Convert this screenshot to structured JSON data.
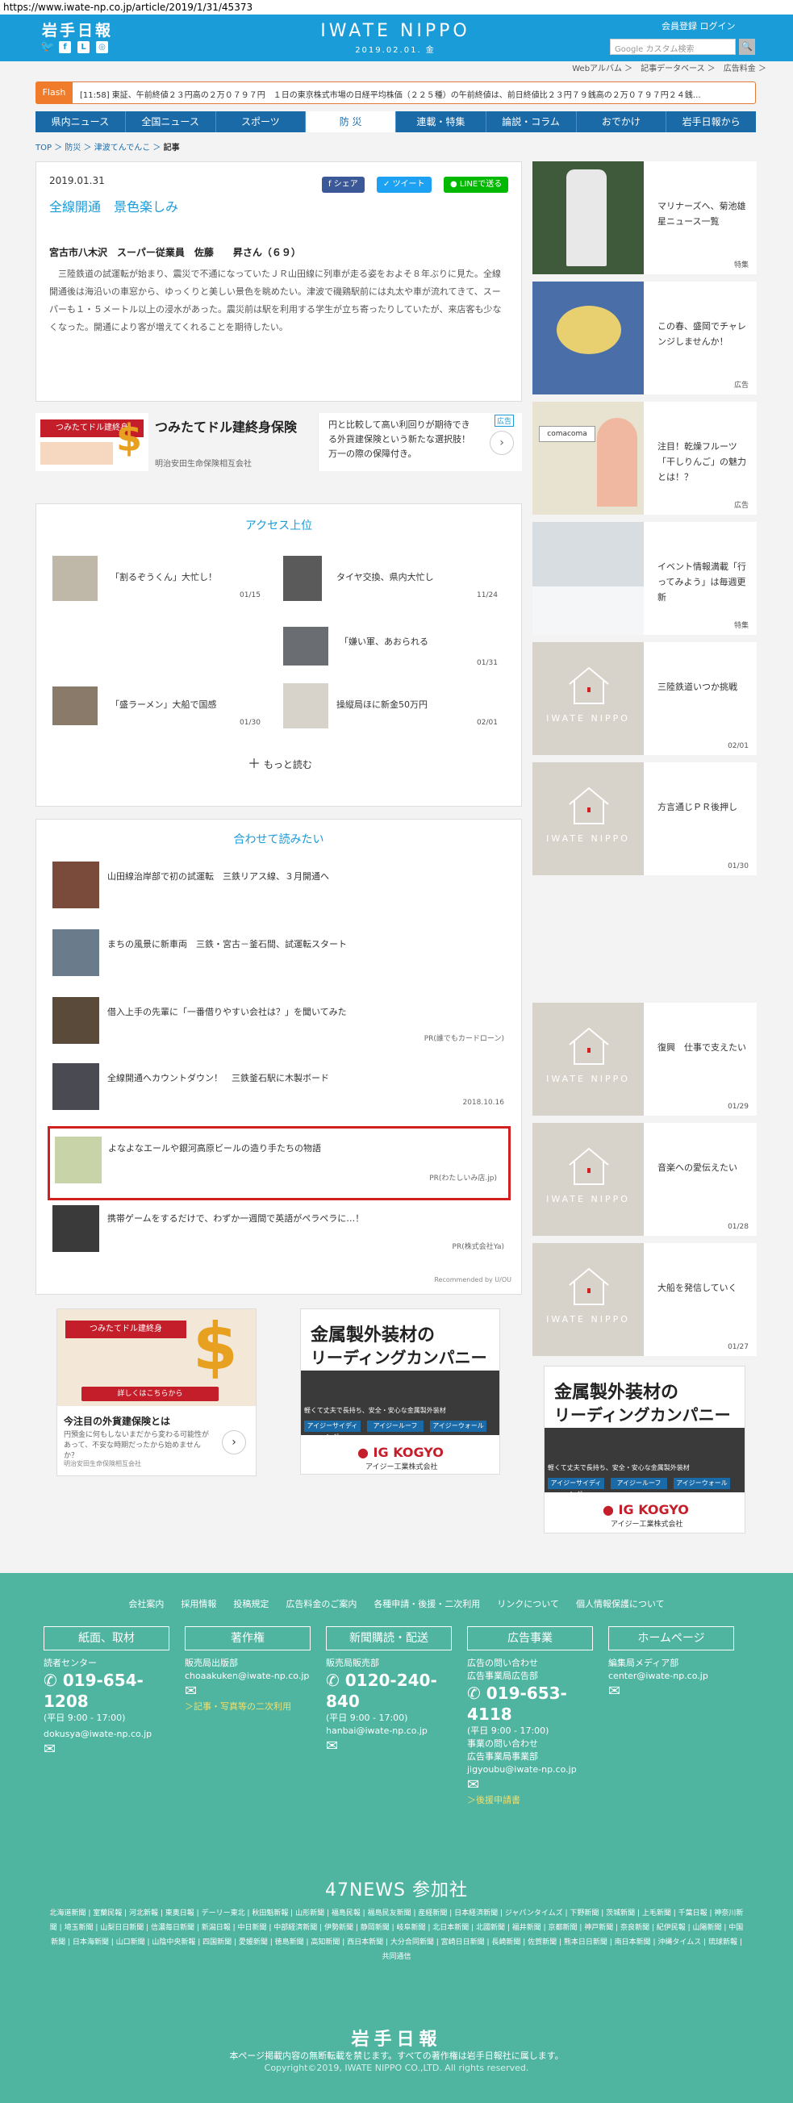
{
  "url": "https://www.iwate-np.co.jp/article/2019/1/31/45373",
  "header": {
    "logo_jp": "岩手日報",
    "logo_en": "IWATE NIPPO",
    "date": "2019.02.01. 金",
    "member_links": "会員登録  ログイン",
    "search_placeholder": "Google カスタム検索",
    "sub_links": "Webアルバム ＞　記事データベース ＞　広告料金 ＞"
  },
  "flash": {
    "tag": "Flash",
    "text": "[11:58] 東証、午前終値２３円高の２万０７９７円　１日の東京株式市場の日経平均株価（２２５種）の午前終値は、前日終値比２３円７９銭高の２万０７９７円２４銭…"
  },
  "nav": [
    "県内ニュース",
    "全国ニュース",
    "スポーツ",
    "防 災",
    "連載・特集",
    "論説・コラム",
    "おでかけ",
    "岩手日報から"
  ],
  "breadcrumb": {
    "a": "TOP",
    "b": "防災",
    "c": "津波てんでんこ",
    "d": "記事"
  },
  "article": {
    "date": "2019.01.31",
    "title": "全線開通　景色楽しみ",
    "share_fb": "シェア",
    "share_tw": "ツイート",
    "share_line": "LINEで送る",
    "author": "宮古市八木沢　スーパー従業員　佐藤　　昇さん（６９）",
    "body": "　三陸鉄道の試運転が始まり、震災で不通になっていたＪＲ山田線に列車が走る姿をおよそ８年ぶりに見た。全線開通後は海沿いの車窓から、ゆっくりと美しい景色を眺めたい。津波で磯鶏駅前には丸太や車が流れてきて、スーパーも１・５メートル以上の浸水があった。震災前は駅を利用する学生が立ち寄ったりしていたが、来店客も少なくなった。開通により客が増えてくれることを期待したい。"
  },
  "ad1": {
    "logo": "つみたてドル建終身",
    "title": "つみたてドル建終身保険",
    "company": "明治安田生命保険相互会社",
    "desc": "円と比較して高い利回りが期待できる外貨建保険という新たな選択肢！万一の際の保障付き。",
    "badge": "広告"
  },
  "ranking": {
    "title": "アクセス上位",
    "items": [
      {
        "title": "「割るぞうくん」大忙し！",
        "date": "01/15"
      },
      {
        "title": "タイヤ交換、県内大忙し",
        "date": "11/24"
      },
      {
        "title": "「嫌い軍、あおられる",
        "date": "01/31"
      },
      {
        "title": "「盛ラーメン」大船で国感",
        "date": "01/30"
      },
      {
        "title": "操縦局ほに新金50万円",
        "date": "02/01"
      }
    ],
    "more": "もっと読む"
  },
  "read": {
    "title": "合わせて読みたい",
    "items": [
      {
        "title": "山田線治岸部で初の試運転　三鉄リアス線、３月開通へ",
        "meta": ""
      },
      {
        "title": "まちの風景に新車両　三鉄・宮古－釜石間、試運転スタート",
        "meta": ""
      },
      {
        "title": "借入上手の先輩に「一番借りやすい会社は？」を聞いてみた",
        "meta": "PR(誰でもカードローン)"
      },
      {
        "title": "全線開通へカウントダウン！　三鉄釜石駅に木製ボード",
        "meta": "2018.10.16"
      },
      {
        "title": "よなよなエールや銀河高原ビールの造り手たちの物語",
        "meta": "PR(わたしいみ店.jp)"
      },
      {
        "title": "携帯ゲームをするだけで、わずか一週間で英語がペラペラに…！",
        "meta": "PR(株式会社Ya)"
      }
    ],
    "recommended": "Recommended by U/OU"
  },
  "ad_bottom_left": {
    "title": "今注目の外貨建保険とは",
    "text": "円預金に何もしないまだから変わる可能性があって、不安な時期だったから始めませんか？",
    "company": "明治安田生命保険相互会社",
    "cta": "詳しくはこちらから"
  },
  "ad_ig": {
    "line1": "金属製外装材の",
    "line2": "リーディングカンパニー",
    "sub": "軽くて丈夫で長持ち、安全・安心な金属製外装材",
    "p1": "アイジーサイディング",
    "p2": "アイジールーフ",
    "p3": "アイジーウォール",
    "brand": "IG KOGYO",
    "brand_jp": "アイジー工業株式会社"
  },
  "sidebar": [
    {
      "title": "マリナーズへ、菊池雄星ニュース一覧",
      "tag": "特集"
    },
    {
      "title": "この春、盛岡でチャレンジしませんか！",
      "tag": "広告"
    },
    {
      "title": "注目！乾燥フルーツ「干しりんご」の魅力とは！？",
      "tag": "広告"
    },
    {
      "title": "イベント情報満載「行ってみよう」は毎週更新",
      "tag": "特集"
    },
    {
      "title": "三陸鉄道いつか挑戦",
      "tag": "02/01"
    },
    {
      "title": "方言通じＰＲ後押し",
      "tag": "01/30"
    },
    {
      "title": "復興　仕事で支えたい",
      "tag": "01/29"
    },
    {
      "title": "音楽への愛伝えたい",
      "tag": "01/28"
    },
    {
      "title": "大船を発信していく",
      "tag": "01/27"
    }
  ],
  "iwate_mark": "IWATE NIPPO",
  "footer": {
    "links": [
      "会社案内",
      "採用情報",
      "投稿規定",
      "広告料金のご案内",
      "各種申請・後援・二次利用",
      "リンクについて",
      "個人情報保護について"
    ],
    "buttons": [
      "紙面、取材",
      "著作権",
      "新聞購読・配送",
      "広告事業",
      "ホームページ"
    ],
    "col1": {
      "label": "読者センター",
      "tel": "019-654-1208",
      "hours": "(平日 9:00 - 17:00)",
      "mail": "dokusya@iwate-np.co.jp"
    },
    "col2": {
      "label": "販売局出版部",
      "mail": "choaakuken@iwate-np.co.jp",
      "link": "＞記事・写真等の二次利用"
    },
    "col3": {
      "label": "販売局販売部",
      "tel": "0120-240-840",
      "hours": "(平日 9:00 - 17:00)",
      "mail": "hanbai@iwate-np.co.jp"
    },
    "col4": {
      "label": "広告の問い合わせ",
      "label2": "広告事業局広告部",
      "tel": "019-653-4118",
      "hours": "(平日 9:00 - 17:00)",
      "label3": "事業の問い合わせ",
      "label4": "広告事業局事業部",
      "mail": "jigyoubu@iwate-np.co.jp",
      "link": "＞後援申請書"
    },
    "col5": {
      "label": "編集局メディア部",
      "mail": "center@iwate-np.co.jp"
    },
    "news47": "47NEWS 参加社",
    "papers": "北海道新聞 | 室蘭民報 | 河北新報 | 東奥日報 | デーリー東北 | 秋田魁新報 | 山形新聞 | 福島民報 | 福島民友新聞 | 産経新聞 | 日本経済新聞 | ジャパンタイムズ | 下野新聞 | 茨城新聞 | 上毛新聞 | 千葉日報 | 神奈川新聞 | 埼玉新聞 | 山梨日日新聞 | 信濃毎日新聞 | 新潟日報 | 中日新聞 | 中部経済新聞 | 伊勢新聞 | 静岡新聞 | 岐阜新聞 | 北日本新聞 | 北國新聞 | 福井新聞 | 京都新聞 | 神戸新聞 | 奈良新聞 | 紀伊民報 | 山陽新聞 | 中国新聞 | 日本海新聞 | 山口新聞 | 山陰中央新報 | 四国新聞 | 愛媛新聞 | 徳島新聞 | 高知新聞 | 西日本新聞 | 大分合同新聞 | 宮崎日日新聞 | 長崎新聞 | 佐賀新聞 | 熊本日日新聞 | 南日本新聞 | 沖縄タイムス | 琉球新報 | 共同通信",
    "logo": "岩手日報",
    "note": "本ページ掲載内容の無断転載を禁じます。すべての著作権は岩手日報社に属します。",
    "copy": "Copyright©2019, IWATE NIPPO CO.,LTD. All rights reserved."
  }
}
